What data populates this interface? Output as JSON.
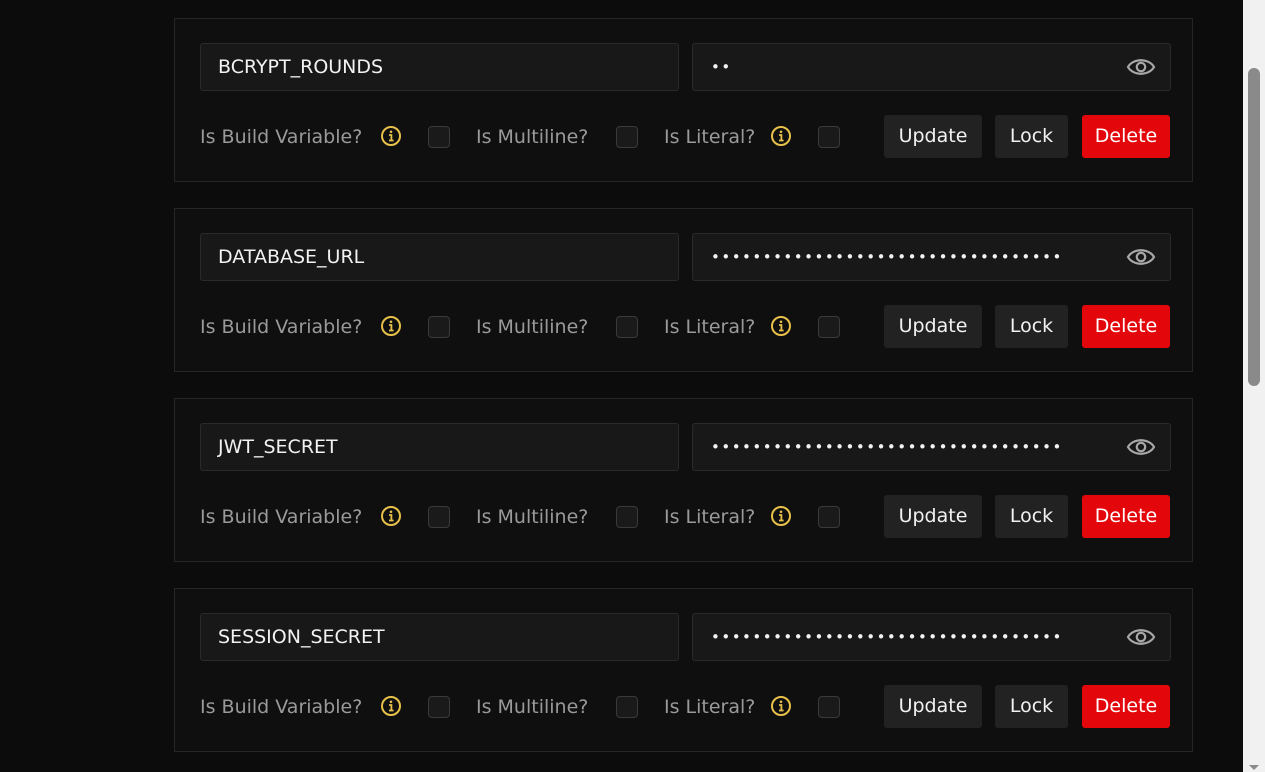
{
  "options": {
    "build_label": "Is Build Variable?",
    "multiline_label": "Is Multiline?",
    "literal_label": "Is Literal?"
  },
  "actions": {
    "update_label": "Update",
    "lock_label": "Lock",
    "delete_label": "Delete"
  },
  "colors": {
    "info_icon": "#e8c14a",
    "delete_button": "#e3070c"
  },
  "icons": {
    "reveal": "eye-icon",
    "info": "info-icon"
  },
  "variables": [
    {
      "key": "BCRYPT_ROUNDS",
      "masked_value": "••"
    },
    {
      "key": "DATABASE_URL",
      "masked_value": "••••••••••••••••••••••••••••••••••"
    },
    {
      "key": "JWT_SECRET",
      "masked_value": "••••••••••••••••••••••••••••••••••"
    },
    {
      "key": "SESSION_SECRET",
      "masked_value": "••••••••••••••••••••••••••••••••••"
    }
  ]
}
